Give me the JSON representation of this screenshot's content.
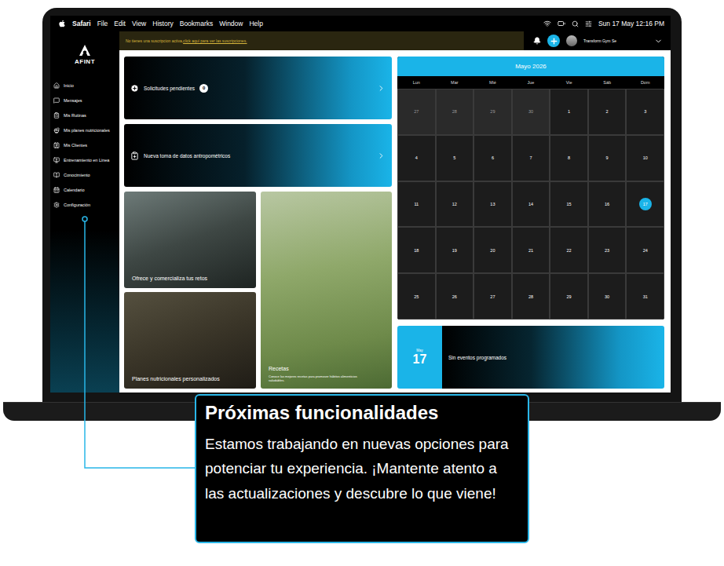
{
  "menubar": {
    "app": "Safari",
    "menus": [
      "File",
      "Edit",
      "View",
      "History",
      "Bookmarks",
      "Window",
      "Help"
    ],
    "clock": "Sun 17 May 12:16 PM"
  },
  "brand": {
    "name": "AFINT"
  },
  "banner": {
    "text": "No tienes una suscripcion activa, ",
    "link": "click aquí para ver las suscripciones."
  },
  "user": {
    "name": "Transform Gym Se"
  },
  "sidebar": {
    "items": [
      {
        "label": "Inicio",
        "selected": false
      },
      {
        "label": "Mensajes",
        "selected": false
      },
      {
        "label": "Mis Rutinas",
        "selected": false
      },
      {
        "label": "Mis planes nutricionales",
        "selected": false
      },
      {
        "label": "Mis Clientes",
        "selected": false
      },
      {
        "label": "Entrenamiento en Linea",
        "selected": false
      },
      {
        "label": "Conocimiento",
        "selected": false
      },
      {
        "label": "Calendario",
        "selected": false
      },
      {
        "label": "Configuración",
        "selected": false
      }
    ]
  },
  "actions": [
    {
      "label": "Solicitudes pendientes",
      "count": "0",
      "kind": "requests"
    },
    {
      "label": "Nueva toma de datos antropométricos",
      "kind": "measure"
    }
  ],
  "features": [
    {
      "title": "Ofrece y comercializa tus retos",
      "kind": "fitness"
    },
    {
      "title": "Planes nutricionales personalizados",
      "kind": "food"
    },
    {
      "title": "Recetas",
      "subtitle": "Conoce las mejores recetas para promover hábitos alimenticios saludables.",
      "kind": "recipes"
    }
  ],
  "calendar": {
    "title": "Mayo 2026",
    "weekdays": [
      "Lun",
      "Mar",
      "Mié",
      "Jue",
      "Vie",
      "Sáb",
      "Dom"
    ],
    "weeks": [
      [
        {
          "day": "27",
          "other_month": true,
          "selected": false
        },
        {
          "day": "28",
          "other_month": true,
          "selected": false
        },
        {
          "day": "29",
          "other_month": true,
          "selected": false
        },
        {
          "day": "30",
          "other_month": true,
          "selected": false
        },
        {
          "day": "1",
          "other_month": false,
          "selected": false
        },
        {
          "day": "2",
          "other_month": false,
          "selected": false
        },
        {
          "day": "3",
          "other_month": false,
          "selected": false
        }
      ],
      [
        {
          "day": "4",
          "other_month": false,
          "selected": false
        },
        {
          "day": "5",
          "other_month": false,
          "selected": false
        },
        {
          "day": "6",
          "other_month": false,
          "selected": false
        },
        {
          "day": "7",
          "other_month": false,
          "selected": false
        },
        {
          "day": "8",
          "other_month": false,
          "selected": false
        },
        {
          "day": "9",
          "other_month": false,
          "selected": false
        },
        {
          "day": "10",
          "other_month": false,
          "selected": false
        }
      ],
      [
        {
          "day": "11",
          "other_month": false,
          "selected": false
        },
        {
          "day": "12",
          "other_month": false,
          "selected": false
        },
        {
          "day": "13",
          "other_month": false,
          "selected": false
        },
        {
          "day": "14",
          "other_month": false,
          "selected": false
        },
        {
          "day": "15",
          "other_month": false,
          "selected": false
        },
        {
          "day": "16",
          "other_month": false,
          "selected": false
        },
        {
          "day": "17",
          "other_month": false,
          "selected": true
        }
      ],
      [
        {
          "day": "18",
          "other_month": false,
          "selected": false
        },
        {
          "day": "19",
          "other_month": false,
          "selected": false
        },
        {
          "day": "20",
          "other_month": false,
          "selected": false
        },
        {
          "day": "21",
          "other_month": false,
          "selected": false
        },
        {
          "day": "22",
          "other_month": false,
          "selected": false
        },
        {
          "day": "23",
          "other_month": false,
          "selected": false
        },
        {
          "day": "24",
          "other_month": false,
          "selected": false
        }
      ],
      [
        {
          "day": "25",
          "other_month": false,
          "selected": false
        },
        {
          "day": "26",
          "other_month": false,
          "selected": false
        },
        {
          "day": "27",
          "other_month": false,
          "selected": false
        },
        {
          "day": "28",
          "other_month": false,
          "selected": false
        },
        {
          "day": "29",
          "other_month": false,
          "selected": false
        },
        {
          "day": "30",
          "other_month": false,
          "selected": false
        },
        {
          "day": "31",
          "other_month": false,
          "selected": false
        }
      ]
    ]
  },
  "event_panel": {
    "month": "May",
    "day": "17",
    "text": "Sin eventos programados"
  },
  "callout": {
    "title": "Próximas funcionalidades",
    "body": "Estamos trabajando en nuevas opciones para potenciar tu experiencia. ¡Mantente atento a las actualizaciones y descubre lo que viene!"
  }
}
